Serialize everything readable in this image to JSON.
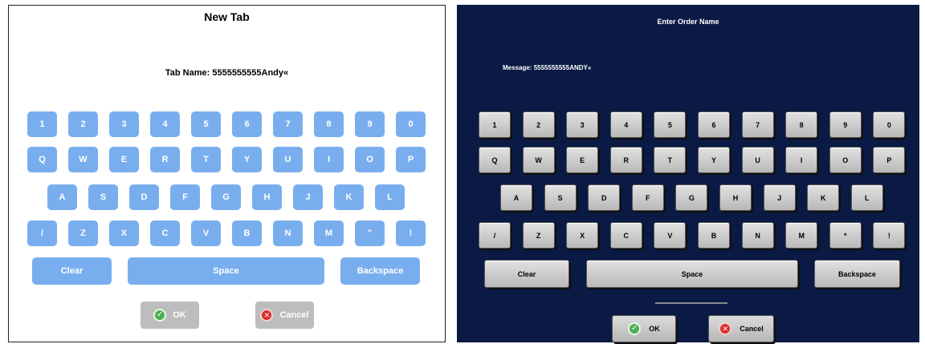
{
  "left": {
    "title": "New Tab",
    "field_label": "Tab Name:",
    "field_value": "5555555555Andy«",
    "rows": [
      [
        "1",
        "2",
        "3",
        "4",
        "5",
        "6",
        "7",
        "8",
        "9",
        "0"
      ],
      [
        "Q",
        "W",
        "E",
        "R",
        "T",
        "Y",
        "U",
        "I",
        "O",
        "P"
      ],
      [
        "A",
        "S",
        "D",
        "F",
        "G",
        "H",
        "J",
        "K",
        "L"
      ],
      [
        "/",
        "Z",
        "X",
        "C",
        "V",
        "B",
        "N",
        "M",
        "\"",
        "!"
      ]
    ],
    "clear_label": "Clear",
    "space_label": "Space",
    "backspace_label": "Backspace",
    "ok_label": "OK",
    "cancel_label": "Cancel"
  },
  "right": {
    "title": "Enter Order Name",
    "field_label": "Message:",
    "field_value": "5555555555ANDY«",
    "rows": [
      [
        "1",
        "2",
        "3",
        "4",
        "5",
        "6",
        "7",
        "8",
        "9",
        "0"
      ],
      [
        "Q",
        "W",
        "E",
        "R",
        "T",
        "Y",
        "U",
        "I",
        "O",
        "P"
      ],
      [
        "A",
        "S",
        "D",
        "F",
        "G",
        "H",
        "J",
        "K",
        "L"
      ],
      [
        "/",
        "Z",
        "X",
        "C",
        "V",
        "B",
        "N",
        "M",
        "*",
        "!"
      ]
    ],
    "clear_label": "Clear",
    "space_label": "Space",
    "backspace_label": "Backspace",
    "ok_label": "OK",
    "cancel_label": "Cancel"
  },
  "colors": {
    "left_key": "#79aeee",
    "right_bg": "#0a1a45",
    "right_key": "#c8c8c8"
  }
}
